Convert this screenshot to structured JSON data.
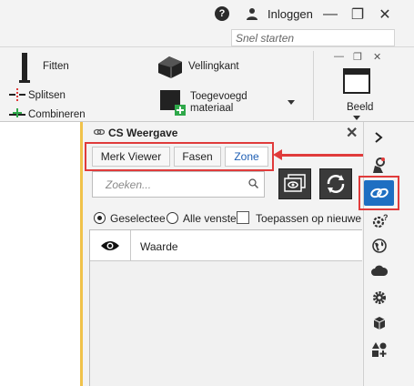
{
  "topbar": {
    "help_label": "?",
    "login_label": "Inloggen",
    "quick_search_placeholder": "Snel starten",
    "minimize_glyph": "—",
    "restore_glyph": "❐",
    "close_glyph": "✕"
  },
  "ribbon": {
    "fitten_label": "Fitten",
    "vellingkant_label": "Vellingkant",
    "splitsen_label": "Splitsen",
    "combineren_label": "Combineren",
    "toegevoegd_line1": "Toegevoegd",
    "toegevoegd_line2": "materiaal",
    "beeld_label": "Beeld"
  },
  "panel": {
    "title": "CS Weergave",
    "close_glyph": "✕",
    "tabs": [
      {
        "label": "Merk Viewer",
        "active": false
      },
      {
        "label": "Fasen",
        "active": false
      },
      {
        "label": "Zone",
        "active": true
      }
    ],
    "search_placeholder": "Zoeken...",
    "options": {
      "selected_label": "Geselectee",
      "all_label": "Alle venste",
      "apply_label": "Toepassen op nieuwe"
    },
    "table": {
      "column_value": "Waarde"
    }
  },
  "colors": {
    "accent_red": "#e03b3b",
    "active_blue": "#1e6fc2",
    "tab_active_text": "#1f5fb4",
    "canvas_border": "#f0c24a",
    "dark_button": "#3a3a3a"
  },
  "icons": {
    "rail": [
      "chevron-right-icon",
      "gear-hand-icon",
      "view-link-icon",
      "help-gear-icon",
      "globe-icon",
      "cloud-icon",
      "gear-icon",
      "cube-icon",
      "shapes-icon"
    ]
  }
}
